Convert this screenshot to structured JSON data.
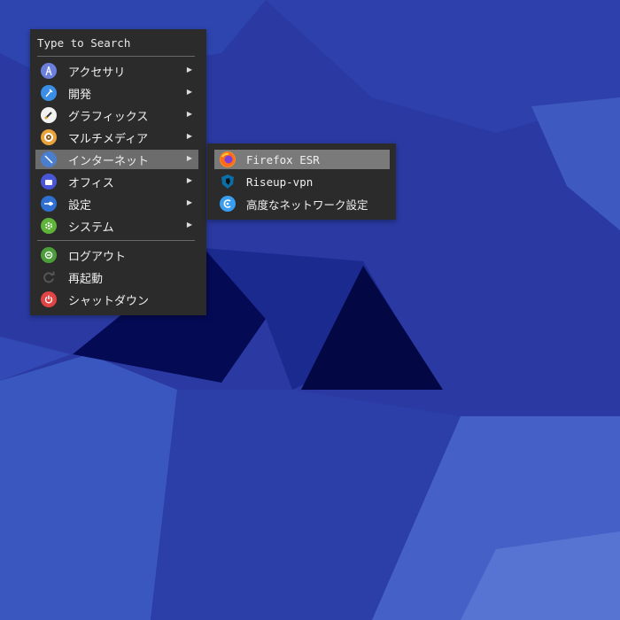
{
  "search": {
    "placeholder": "Type to Search"
  },
  "menu": {
    "items": [
      {
        "label": "アクセサリ",
        "icon": "accessories-icon",
        "color": "#6b7fdc",
        "has_sub": true
      },
      {
        "label": "開発",
        "icon": "development-icon",
        "color": "#3a8ee6",
        "has_sub": true
      },
      {
        "label": "グラフィックス",
        "icon": "graphics-icon",
        "color": "#f0f0f0",
        "has_sub": true
      },
      {
        "label": "マルチメディア",
        "icon": "multimedia-icon",
        "color": "#e8a33a",
        "has_sub": true
      },
      {
        "label": "インターネット",
        "icon": "internet-icon",
        "color": "#4a7fd0",
        "has_sub": true,
        "highlighted": true
      },
      {
        "label": "オフィス",
        "icon": "office-icon",
        "color": "#4a56d8",
        "has_sub": true
      },
      {
        "label": "設定",
        "icon": "settings-icon",
        "color": "#2e6fd0",
        "has_sub": true
      },
      {
        "label": "システム",
        "icon": "system-icon",
        "color": "#5fb33a",
        "has_sub": true
      }
    ],
    "session": [
      {
        "label": "ログアウト",
        "icon": "logout-icon",
        "color": "#4c9e3a"
      },
      {
        "label": "再起動",
        "icon": "restart-icon",
        "color": "#555555"
      },
      {
        "label": "シャットダウン",
        "icon": "shutdown-icon",
        "color": "#e04444"
      }
    ],
    "arrow_glyph": "▶"
  },
  "submenu": {
    "items": [
      {
        "label": "Firefox ESR",
        "icon": "firefox-icon",
        "highlighted": true
      },
      {
        "label": "Riseup-vpn",
        "icon": "riseup-vpn-icon"
      },
      {
        "label": "高度なネットワーク設定",
        "icon": "network-settings-icon"
      }
    ]
  }
}
